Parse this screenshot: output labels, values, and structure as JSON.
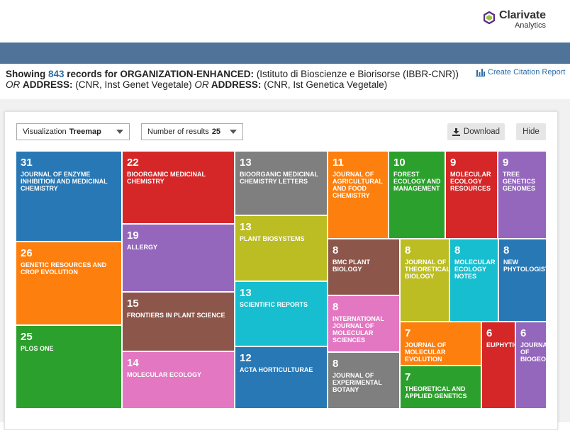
{
  "brand": {
    "name": "Clarivate",
    "sub": "Analytics"
  },
  "summary": {
    "prefix": "Showing ",
    "count": "843",
    "mid": " records for ",
    "field1": "ORGANIZATION-ENHANCED:",
    "value1": " (Istituto di Bioscienze e Biorisorse (IBBR-CNR)) ",
    "or1": "OR",
    "field2": "ADDRESS:",
    "value2": " (CNR, Inst Genet Vegetale) ",
    "or2": "OR",
    "field3": " ADDRESS:",
    "value3": " (CNR, Ist Genetica Vegetale)"
  },
  "citation_report_label": "Create Citation Report",
  "controls": {
    "visualization_label": "Visualization",
    "visualization_value": "Treemap",
    "results_label": "Number of results",
    "results_value": "25",
    "download_label": "Download",
    "hide_label": "Hide"
  },
  "colors": {
    "blue": "#2878b5",
    "red": "#d62728",
    "gray": "#7f7f7f",
    "orange": "#fd7f0e",
    "green": "#2ca02c",
    "purple": "#9467bd",
    "olive": "#bcbd22",
    "cyan": "#17becf",
    "brown": "#8c564b",
    "pink": "#e377c2",
    "header": "#4f7399",
    "link": "#2b6ca8"
  },
  "chart_data": {
    "type": "treemap",
    "items": [
      {
        "value": 31,
        "label": "JOURNAL OF ENZYME INHIBITION AND MEDICINAL CHEMISTRY",
        "color": "#2878b5"
      },
      {
        "value": 26,
        "label": "GENETIC RESOURCES AND CROP EVOLUTION",
        "color": "#fd7f0e"
      },
      {
        "value": 25,
        "label": "PLOS ONE",
        "color": "#2ca02c"
      },
      {
        "value": 22,
        "label": "BIOORGANIC MEDICINAL CHEMISTRY",
        "color": "#d62728"
      },
      {
        "value": 19,
        "label": "ALLERGY",
        "color": "#9467bd"
      },
      {
        "value": 15,
        "label": "FRONTIERS IN PLANT SCIENCE",
        "color": "#8c564b"
      },
      {
        "value": 14,
        "label": "MOLECULAR ECOLOGY",
        "color": "#e377c2"
      },
      {
        "value": 13,
        "label": "BIOORGANIC MEDICINAL CHEMISTRY LETTERS",
        "color": "#7f7f7f"
      },
      {
        "value": 13,
        "label": "PLANT BIOSYSTEMS",
        "color": "#bcbd22"
      },
      {
        "value": 13,
        "label": "SCIENTIFIC REPORTS",
        "color": "#17becf"
      },
      {
        "value": 12,
        "label": "ACTA HORTICULTURAE",
        "color": "#2878b5"
      },
      {
        "value": 11,
        "label": "JOURNAL OF AGRICULTURAL AND FOOD CHEMISTRY",
        "color": "#fd7f0e"
      },
      {
        "value": 10,
        "label": "FOREST ECOLOGY AND MANAGEMENT",
        "color": "#2ca02c"
      },
      {
        "value": 9,
        "label": "MOLECULAR ECOLOGY RESOURCES",
        "color": "#d62728"
      },
      {
        "value": 9,
        "label": "TREE GENETICS GENOMES",
        "color": "#9467bd"
      },
      {
        "value": 8,
        "label": "BMC PLANT BIOLOGY",
        "color": "#8c564b"
      },
      {
        "value": 8,
        "label": "JOURNAL OF THEORETICAL BIOLOGY",
        "color": "#bcbd22"
      },
      {
        "value": 8,
        "label": "MOLECULAR ECOLOGY NOTES",
        "color": "#17becf"
      },
      {
        "value": 8,
        "label": "NEW PHYTOLOGIST",
        "color": "#2878b5"
      },
      {
        "value": 8,
        "label": "INTERNATIONAL JOURNAL OF MOLECULAR SCIENCES",
        "color": "#e377c2"
      },
      {
        "value": 8,
        "label": "JOURNAL OF EXPERIMENTAL BOTANY",
        "color": "#7f7f7f"
      },
      {
        "value": 7,
        "label": "JOURNAL OF MOLECULAR EVOLUTION",
        "color": "#fd7f0e"
      },
      {
        "value": 7,
        "label": "THEORETICAL AND APPLIED GENETICS",
        "color": "#2ca02c"
      },
      {
        "value": 6,
        "label": "EUPHYTICA",
        "color": "#d62728"
      },
      {
        "value": 6,
        "label": "JOURNAL OF BIOGEOGRAPHY",
        "color": "#9467bd"
      }
    ]
  }
}
